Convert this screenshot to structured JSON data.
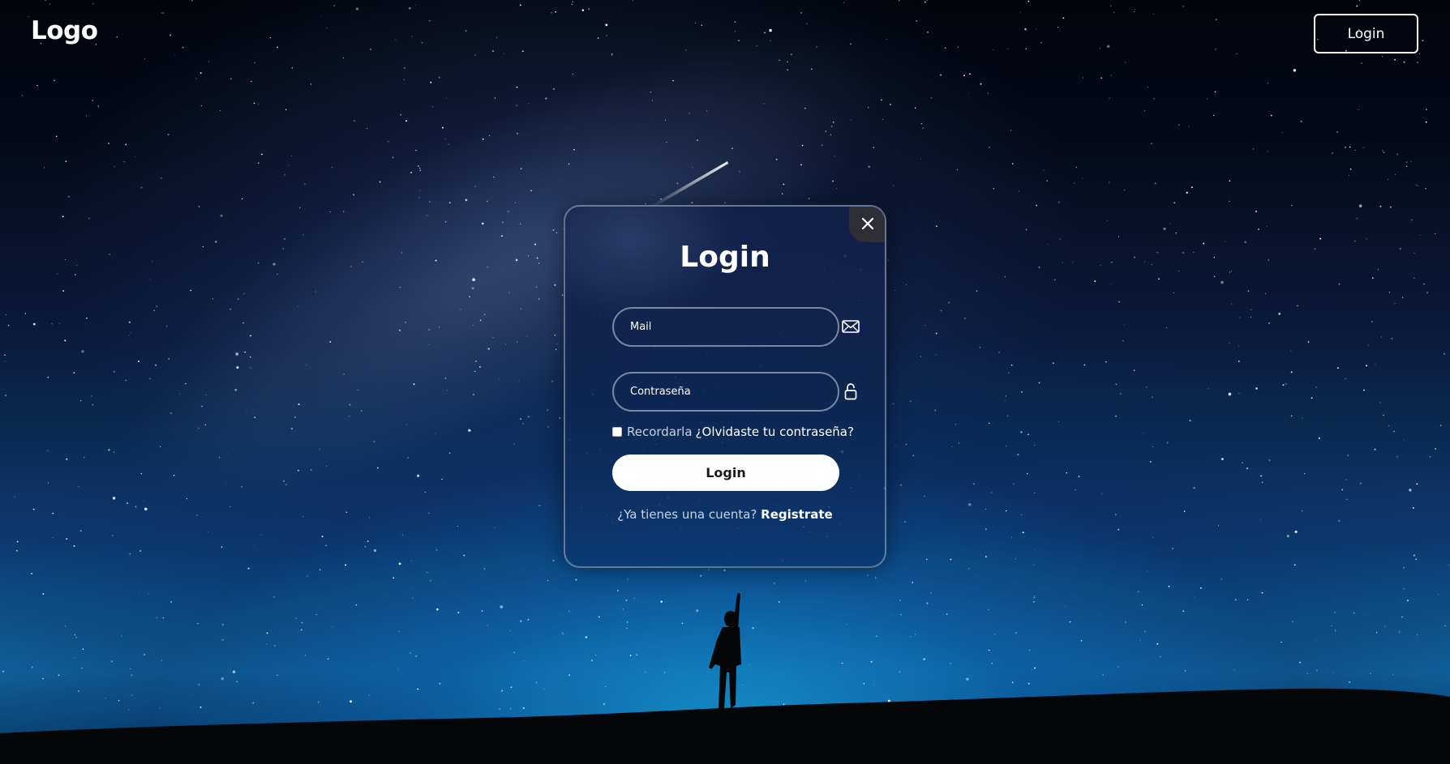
{
  "header": {
    "logo_text": "Logo",
    "login_button_label": "Login"
  },
  "modal": {
    "title": "Login",
    "close_icon": "close-icon",
    "email": {
      "placeholder": "Mail",
      "icon": "envelope-icon"
    },
    "password": {
      "placeholder": "Contraseña",
      "icon": "lock-icon"
    },
    "remember_label": "Recordarla",
    "remember_checked": false,
    "forgot_link": "¿Olvidaste tu contraseña?",
    "submit_label": "Login",
    "register_question": "¿Ya tienes una cuenta?",
    "register_link": "Registrate"
  },
  "colors": {
    "accent": "#ffffff",
    "modal_bg": "#12284f",
    "close_button_bg": "#2e2f36"
  }
}
